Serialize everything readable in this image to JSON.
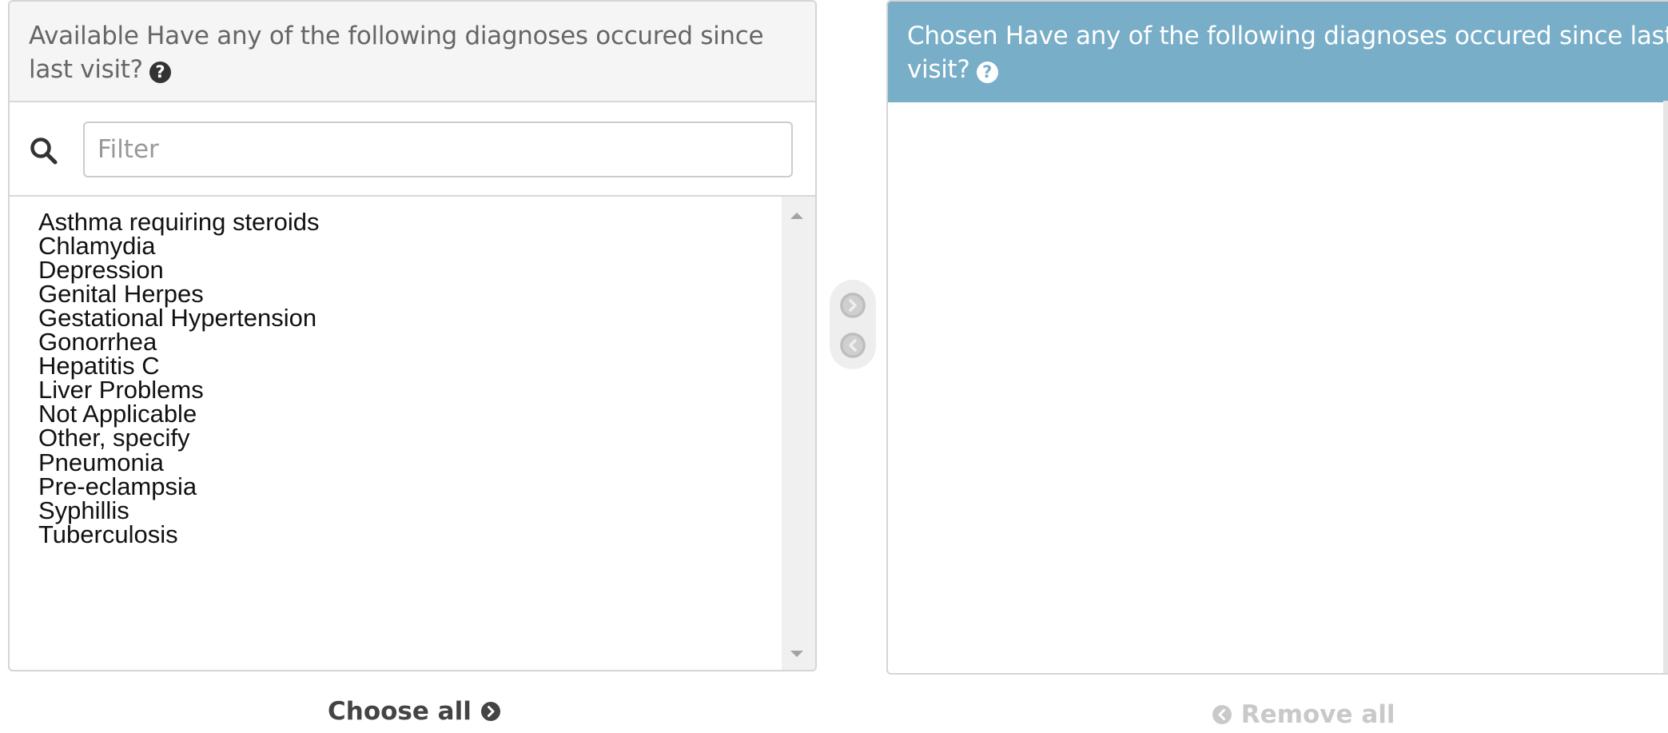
{
  "available": {
    "title": "Available Have any of the following diagnoses occured since last visit?",
    "help_icon": "question-circle-icon",
    "search_icon": "magnifier-icon",
    "filter": {
      "value": "",
      "placeholder": "Filter"
    },
    "options": [
      "Asthma requiring steroids",
      "Chlamydia",
      "Depression",
      "Genital Herpes",
      "Gestational Hypertension",
      "Gonorrhea",
      "Hepatitis C",
      "Liver Problems",
      "Not Applicable",
      "Other, specify",
      "Pneumonia",
      "Pre-eclampsia",
      "Syphillis",
      "Tuberculosis"
    ]
  },
  "chosen": {
    "title": "Chosen Have any of the following diagnoses occured since last visit?",
    "help_icon": "question-circle-icon",
    "options": []
  },
  "controls": {
    "add_icon": "arrow-right-circle-icon",
    "remove_icon": "arrow-left-circle-icon"
  },
  "footer": {
    "choose_all_label": "Choose all",
    "remove_all_label": "Remove all"
  },
  "colors": {
    "chosen_header_bg": "#79aec8",
    "available_header_bg": "#f5f5f5",
    "disabled_text": "#c9c9c9"
  }
}
